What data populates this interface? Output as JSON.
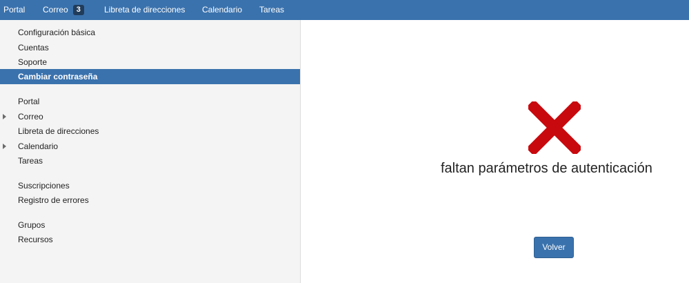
{
  "topnav": {
    "portal": "Portal",
    "correo": "Correo",
    "correo_badge": "3",
    "libreta": "Libreta de direcciones",
    "calendario": "Calendario",
    "tareas": "Tareas"
  },
  "sidebar": {
    "items": [
      {
        "label": "Configuración básica"
      },
      {
        "label": "Cuentas"
      },
      {
        "label": "Soporte"
      },
      {
        "label": "Cambiar contraseña",
        "active": true
      },
      {
        "label": "Portal"
      },
      {
        "label": "Correo",
        "expandable": true
      },
      {
        "label": "Libreta de direcciones"
      },
      {
        "label": "Calendario",
        "expandable": true
      },
      {
        "label": "Tareas"
      },
      {
        "label": "Suscripciones"
      },
      {
        "label": "Registro de errores"
      },
      {
        "label": "Grupos"
      },
      {
        "label": "Recursos"
      }
    ]
  },
  "main": {
    "error_icon": "close-x-icon",
    "error_message": "faltan parámetros de autenticación",
    "back_button": "Volver"
  },
  "colors": {
    "nav_blue": "#3a72ad",
    "badge_bg": "#213c5b",
    "error_red": "#c8090e",
    "sidebar_bg": "#f4f4f4"
  }
}
